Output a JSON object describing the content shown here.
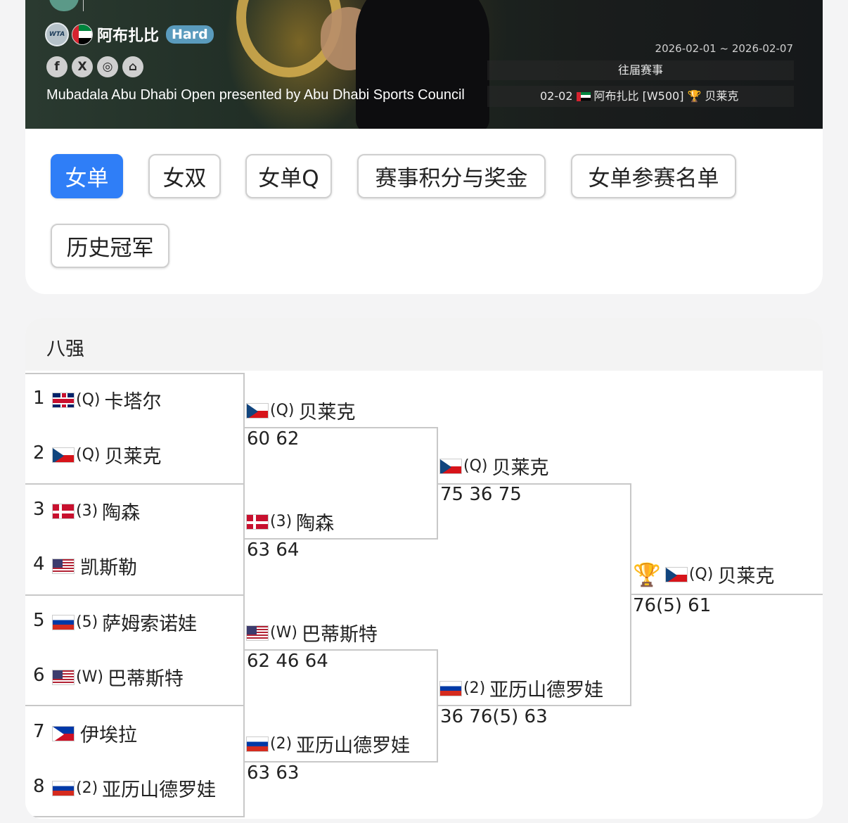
{
  "banner": {
    "city": "阿布扎比",
    "surface": "Hard",
    "wta_badge": "WTA",
    "date_range": "2026-02-01 ~ 2026-02-07",
    "full_name": "Mubadala Abu Dhabi Open presented by Abu Dhabi Sports Council",
    "past_label": "往届赛事",
    "past_entry": {
      "date": "02-02",
      "city": "阿布扎比 [W500]",
      "trophy": "🏆",
      "champion": "贝莱克"
    },
    "social_icons": [
      "facebook-icon",
      "x-icon",
      "instagram-icon",
      "home-icon"
    ],
    "social_glyphs": [
      "f",
      "X",
      "◎",
      "⌂"
    ]
  },
  "tabs": [
    "女单",
    "女双",
    "女单Q",
    "赛事积分与奖金",
    "女单参赛名单",
    "历史冠军"
  ],
  "active_tab": 0,
  "bracket": {
    "title": "八强",
    "round1": [
      {
        "num": "1",
        "flag": "gb",
        "seed": "(Q)",
        "name": "卡塔尔"
      },
      {
        "num": "2",
        "flag": "cz",
        "seed": "(Q)",
        "name": "贝莱克"
      },
      {
        "num": "3",
        "flag": "dk",
        "seed": "(3)",
        "name": "陶森"
      },
      {
        "num": "4",
        "flag": "us",
        "seed": "",
        "name": "凯斯勒"
      },
      {
        "num": "5",
        "flag": "ru",
        "seed": "(5)",
        "name": "萨姆索诺娃"
      },
      {
        "num": "6",
        "flag": "us",
        "seed": "(W)",
        "name": "巴蒂斯特"
      },
      {
        "num": "7",
        "flag": "ph",
        "seed": "",
        "name": "伊埃拉"
      },
      {
        "num": "8",
        "flag": "ru",
        "seed": "(2)",
        "name": "亚历山德罗娃"
      }
    ],
    "semifinal": [
      {
        "flag": "cz",
        "seed": "(Q)",
        "name": "贝莱克",
        "score": "60 62"
      },
      {
        "flag": "dk",
        "seed": "(3)",
        "name": "陶森",
        "score": "63 64"
      },
      {
        "flag": "us",
        "seed": "(W)",
        "name": "巴蒂斯特",
        "score": "62 46 64"
      },
      {
        "flag": "ru",
        "seed": "(2)",
        "name": "亚历山德罗娃",
        "score": "63 63"
      }
    ],
    "final": [
      {
        "flag": "cz",
        "seed": "(Q)",
        "name": "贝莱克",
        "score": "75 36 75"
      },
      {
        "flag": "ru",
        "seed": "(2)",
        "name": "亚历山德罗娃",
        "score": "36 76(5) 63"
      }
    ],
    "champion": {
      "trophy": "🏆",
      "flag": "cz",
      "seed": "(Q)",
      "name": "贝莱克",
      "score": "76(5) 61"
    }
  }
}
